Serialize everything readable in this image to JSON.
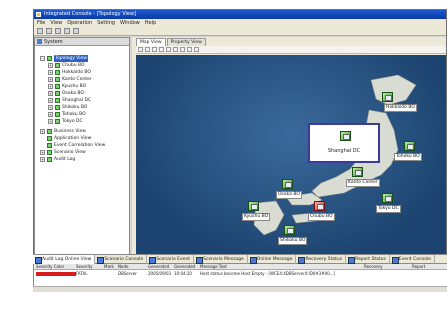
{
  "window": {
    "title": "Integrated Console - [Topology View]"
  },
  "menu": [
    "File",
    "View",
    "Operation",
    "Setting",
    "Window",
    "Help"
  ],
  "tree": {
    "header": "System",
    "items": [
      {
        "label": "Topology View",
        "level": 1,
        "selected": true,
        "expander": "−"
      },
      {
        "label": "Chubu BO",
        "level": 2,
        "expander": "+"
      },
      {
        "label": "Hokkaido BO",
        "level": 2,
        "expander": "+"
      },
      {
        "label": "Kanto Center",
        "level": 2,
        "expander": "+"
      },
      {
        "label": "Kyushu BO",
        "level": 2,
        "expander": "+"
      },
      {
        "label": "Osaka BO",
        "level": 2,
        "expander": "+"
      },
      {
        "label": "Shanghai DC",
        "level": 2,
        "expander": "+"
      },
      {
        "label": "Shikoku BO",
        "level": 2,
        "expander": "+"
      },
      {
        "label": "Tohoku BO",
        "level": 2,
        "expander": "+"
      },
      {
        "label": "Tokyo DC",
        "level": 2,
        "expander": "+"
      },
      {
        "label": "Business View",
        "level": 1,
        "expander": "+"
      },
      {
        "label": "Application View",
        "level": 1,
        "expander": ""
      },
      {
        "label": "Event Correlation View",
        "level": 1,
        "expander": ""
      },
      {
        "label": "Scenario View",
        "level": 1,
        "expander": "+"
      },
      {
        "label": "Audit Log",
        "level": 1,
        "expander": "+"
      }
    ]
  },
  "tabs": [
    "Map View",
    "Property View"
  ],
  "map": {
    "sites": [
      {
        "label": "Hokkaido BO",
        "alarm": false
      },
      {
        "label": "Tohoku BO",
        "alarm": false
      },
      {
        "label": "Kanto Center",
        "alarm": false
      },
      {
        "label": "Osaka BO",
        "alarm": false
      },
      {
        "label": "Tokyo DC",
        "alarm": false
      },
      {
        "label": "Kyushu BO",
        "alarm": false
      },
      {
        "label": "Chubu BO",
        "alarm": true
      },
      {
        "label": "Shikoku BO",
        "alarm": false
      }
    ],
    "popup_label": "Shanghai DC"
  },
  "bottom_tabs": [
    "Audit Log Online View",
    "Scenario Console",
    "Scenario Event",
    "Scenario Message",
    "Online Message",
    "Recovery Status",
    "Report Status",
    "Event Console"
  ],
  "alarm_table": {
    "headers": [
      "Severity Color",
      "Severity",
      "Mark",
      "Node",
      "Generated",
      "Generated",
      "Message Text",
      "Recovery",
      "Report"
    ],
    "row": [
      "",
      "FATAL",
      "",
      "DBServer",
      "2005/09/03",
      "10:04:20",
      "Host status become Host Empty - [WCE4:4DBServer4:ID0#3#00...]",
      "",
      ""
    ]
  },
  "colors": {
    "alarm": "#d91b1b",
    "title_bar": "#0b3aa6",
    "selection": "#3163c5"
  }
}
